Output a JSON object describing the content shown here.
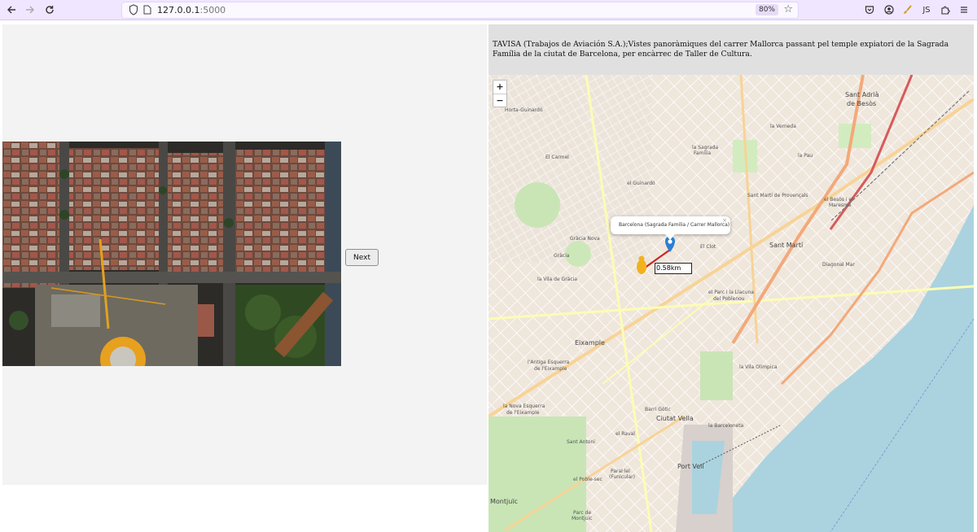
{
  "browser": {
    "url_host": "127.0.0.1",
    "url_port": ":5000",
    "zoom": "80%"
  },
  "left": {
    "next_label": "Next"
  },
  "caption": "TAVISA (Trabajos de Aviación S.A.);Vistes panoràmiques del carrer Mallorca passant pel temple expiatori de la Sagrada Família de la ciutat de Barcelona, per encàrrec de Taller de Cultura.",
  "map": {
    "zoom_in": "+",
    "zoom_out": "−",
    "popup_text": "Barcelona (Sagrada Familia / Carrer Mallorca)",
    "popup_close": "×",
    "distance": "0.58km",
    "labels": {
      "horta": "Horta-Guinardó",
      "sant_adria": "Sant Adrià",
      "de_besos": "de Besòs",
      "la_sagrada": "la Sagrada",
      "familia": "Família",
      "el_carmel": "El Carmel",
      "el_guinardo": "el Guinardó",
      "gracia_nova": "Gràcia Nova",
      "gracia": "Gràcia",
      "vila_gracia": "la Vila de Gràcia",
      "el_clot": "El Clot",
      "sant_marti": "Sant Martí",
      "diagonal_mar": "Diagonal Mar",
      "parc_llacuna": "el Parc i la Llacuna",
      "poblenou": "del Poblenou",
      "eixample": "Eixample",
      "antiga_esquerra": "l'Antiga Esquerra",
      "de_eixample": "de l'Eixample",
      "nova_esquerra": "la Nova Esquerra",
      "de_eixample2": "de l'Eixample",
      "sant_antoni": "Sant Antoni",
      "barri_gotic": "Barri Gòtic",
      "ciutat_vella": "Ciutat Vella",
      "el_raval": "el Raval",
      "la_barceloneta": "la Barceloneta",
      "vila_olimpica": "la Vila Olímpica",
      "port_vell": "Port Vell",
      "poble_sec": "el Poble-sec",
      "montjuic": "Montjuïc",
      "parc_montjuic": "Parc de",
      "montjuic2": "Montjuïc",
      "la_verneda": "la Verneda",
      "la_pau": "la Pau",
      "besos_maresme": "el Besòs i el",
      "maresme": "Maresme",
      "provencals": "Sant Martí de Provençals",
      "parallel": "Paral·lel",
      "funicular": "(Funicular)"
    }
  }
}
